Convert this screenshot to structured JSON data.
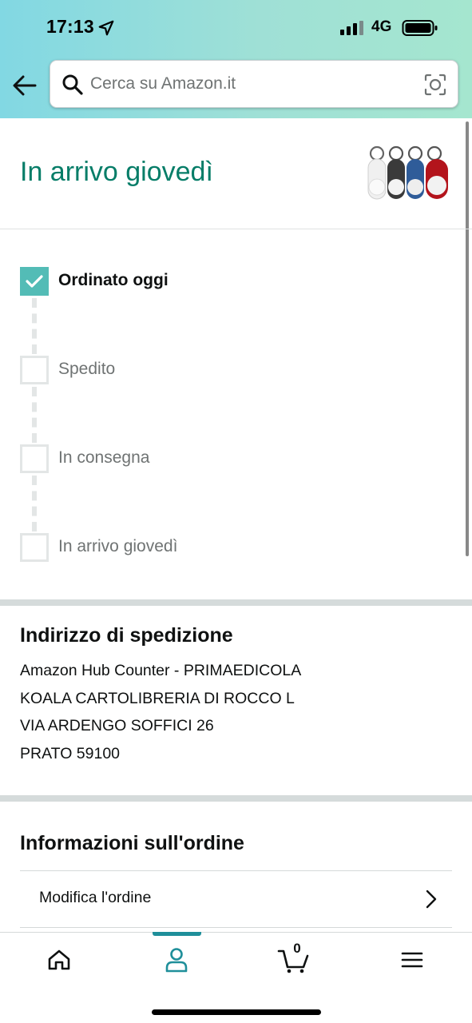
{
  "status_bar": {
    "time": "17:13",
    "network": "4G"
  },
  "search": {
    "placeholder": "Cerca su Amazon.it"
  },
  "delivery": {
    "headline": "In arrivo giovedì"
  },
  "tracking": {
    "steps": [
      {
        "label": "Ordinato oggi",
        "done": true
      },
      {
        "label": "Spedito",
        "done": false
      },
      {
        "label": "In consegna",
        "done": false
      },
      {
        "label": "In arrivo giovedì",
        "done": false
      }
    ]
  },
  "shipping_address": {
    "title": "Indirizzo di spedizione",
    "lines": [
      "Amazon Hub Counter - PRIMAEDICOLA",
      "KOALA CARTOLIBRERIA DI ROCCO L",
      "VIA ARDENGO SOFFICI 26",
      "PRATO 59100"
    ]
  },
  "order_info": {
    "title": "Informazioni sull'ordine",
    "rows": [
      {
        "label": "Modifica l'ordine"
      }
    ]
  },
  "bottom_nav": {
    "items": [
      {
        "icon": "home-icon",
        "active": false
      },
      {
        "icon": "user-icon",
        "active": true
      },
      {
        "icon": "cart-icon",
        "active": false
      },
      {
        "icon": "menu-icon",
        "active": false
      }
    ],
    "cart_count": "0"
  },
  "colors": {
    "accent": "#067d68",
    "check": "#53bcb6",
    "nav_active": "#1f8f9a",
    "header_gradient_start": "#82d8e3",
    "header_gradient_end": "#a5e6cf"
  }
}
